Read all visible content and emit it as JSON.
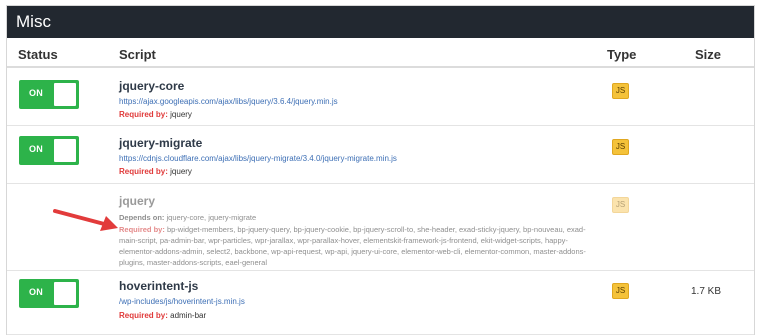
{
  "panel": {
    "title": "Misc"
  },
  "columns": {
    "status": "Status",
    "script": "Script",
    "type": "Type",
    "size": "Size"
  },
  "toggle_label": "ON",
  "type_badge": "JS",
  "required_label": "Required by:",
  "depends_label": "Depends on:",
  "rows": [
    {
      "name": "jquery-core",
      "url": "https://ajax.googleapis.com/ajax/libs/jquery/3.6.4/jquery.min.js",
      "required_by": "jquery",
      "size": ""
    },
    {
      "name": "jquery-migrate",
      "url": "https://cdnjs.cloudflare.com/ajax/libs/jquery-migrate/3.4.0/jquery-migrate.min.js",
      "required_by": "jquery",
      "size": ""
    },
    {
      "name": "jquery",
      "depends_on": "jquery-core, jquery-migrate",
      "required_by": "bp-widget-members, bp-jquery-query, bp-jquery-cookie, bp-jquery-scroll-to, she-header, exad-sticky-jquery, bp-nouveau, exad-main-script, pa-admin-bar, wpr-particles, wpr-jarallax, wpr-parallax-hover, elementskit-framework-js-frontend, ekit-widget-scripts, happy-elementor-addons-admin, select2, backbone, wp-api-request, wp-api, jquery-ui-core, elementor-web-cli, elementor-common, master-addons-plugins, master-addons-scripts, eael-general",
      "size": ""
    },
    {
      "name": "hoverintent-js",
      "url": "/wp-includes/js/hoverintent-js.min.js",
      "required_by": "admin-bar",
      "size": "1.7 KB"
    }
  ],
  "colors": {
    "header_bg": "#222830",
    "toggle_on": "#2db34a",
    "badge": "#f4c23a",
    "required_label": "#e03a3a",
    "arrow": "#e23b3b"
  }
}
